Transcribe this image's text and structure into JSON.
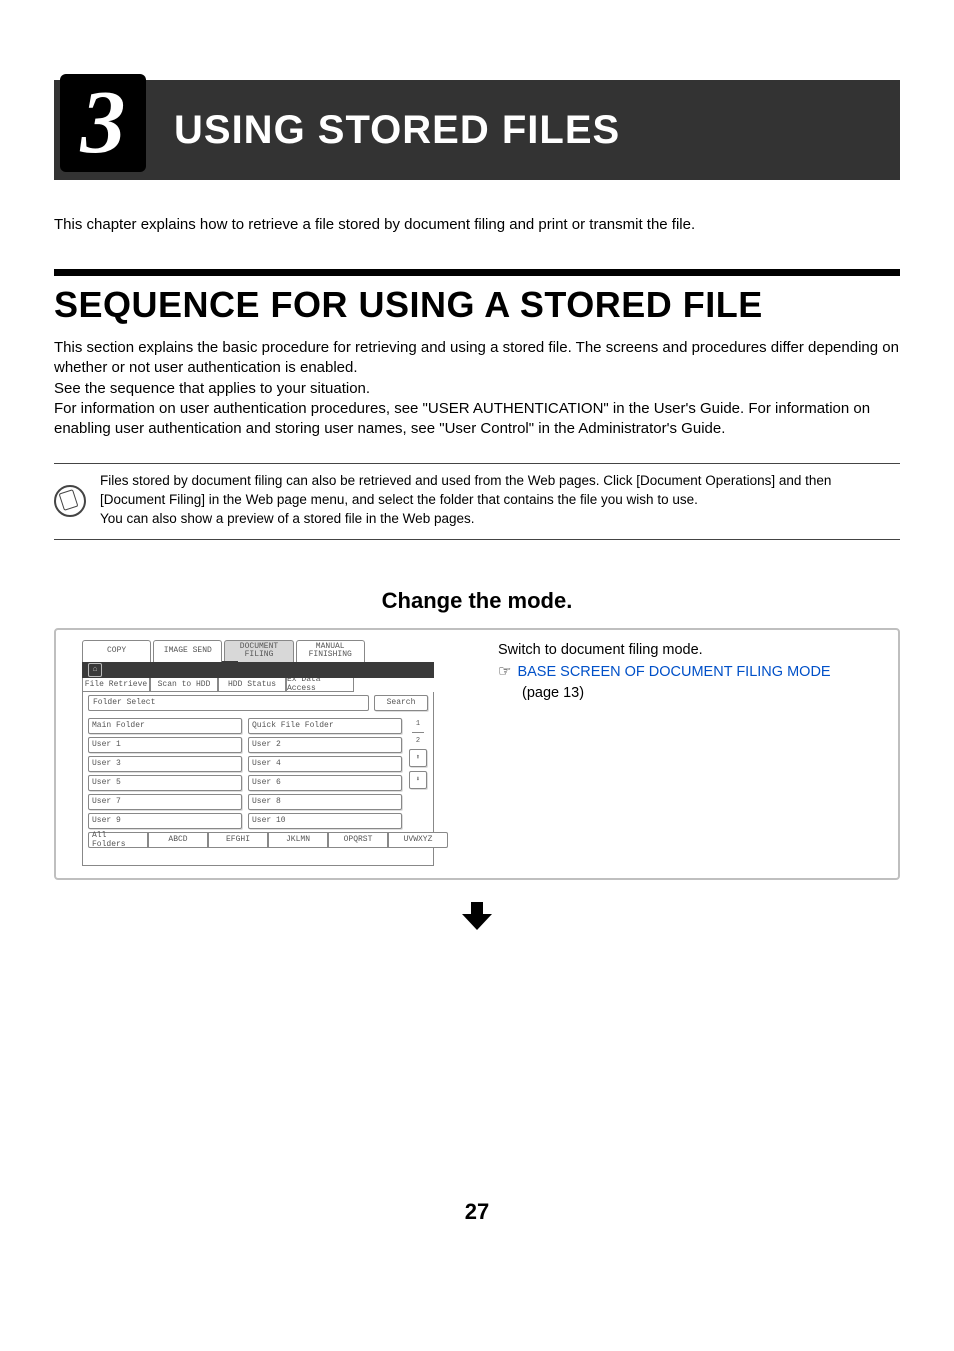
{
  "chapter": {
    "number": "3",
    "title": "USING STORED FILES"
  },
  "intro": "This chapter explains how to retrieve a file stored by document filing and print or transmit the file.",
  "section_heading": "SEQUENCE FOR USING A STORED FILE",
  "body_p1": "This section explains the basic procedure for retrieving and using a stored file. The screens and procedures differ depending on whether or not user authentication is enabled.",
  "body_p2": "See the sequence that applies to your situation.",
  "body_p3": "For information on user authentication procedures, see \"USER AUTHENTICATION\" in the User's Guide. For information on enabling user authentication and storing user names, see \"User Control\" in the Administrator's Guide.",
  "note_l1": "Files stored by document filing can also be retrieved and used from the Web pages. Click [Document Operations] and then [Document Filing] in the Web page menu, and select the folder that contains the file you wish to use.",
  "note_l2": "You can also show a preview of a stored file in the Web pages.",
  "step": {
    "title": "Change the mode.",
    "right_l1": "Switch to document filing mode.",
    "right_link": "BASE SCREEN OF DOCUMENT FILING MODE",
    "right_l2": "(page 13)"
  },
  "ui": {
    "top_tabs": [
      "COPY",
      "IMAGE SEND",
      "DOCUMENT\nFILING",
      "MANUAL\nFINISHING"
    ],
    "sub_tabs": [
      "File Retrieve",
      "Scan to HDD",
      "HDD Status",
      "Ex Data Access"
    ],
    "folder_select_label": "Folder Select",
    "search_btn": "Search",
    "row1": [
      "Main Folder",
      "Quick File Folder"
    ],
    "rows": [
      [
        "User 1",
        "User 2"
      ],
      [
        "User 3",
        "User 4"
      ],
      [
        "User 5",
        "User 6"
      ],
      [
        "User 7",
        "User 8"
      ],
      [
        "User 9",
        "User 10"
      ]
    ],
    "page_indicator_top": "1",
    "page_indicator_bottom": "2",
    "scroll_up": "⬆",
    "scroll_down": "⬇",
    "bottom_tabs": [
      "All Folders",
      "ABCD",
      "EFGHI",
      "JKLMN",
      "OPQRST",
      "UVWXYZ"
    ]
  },
  "page_number": "27"
}
